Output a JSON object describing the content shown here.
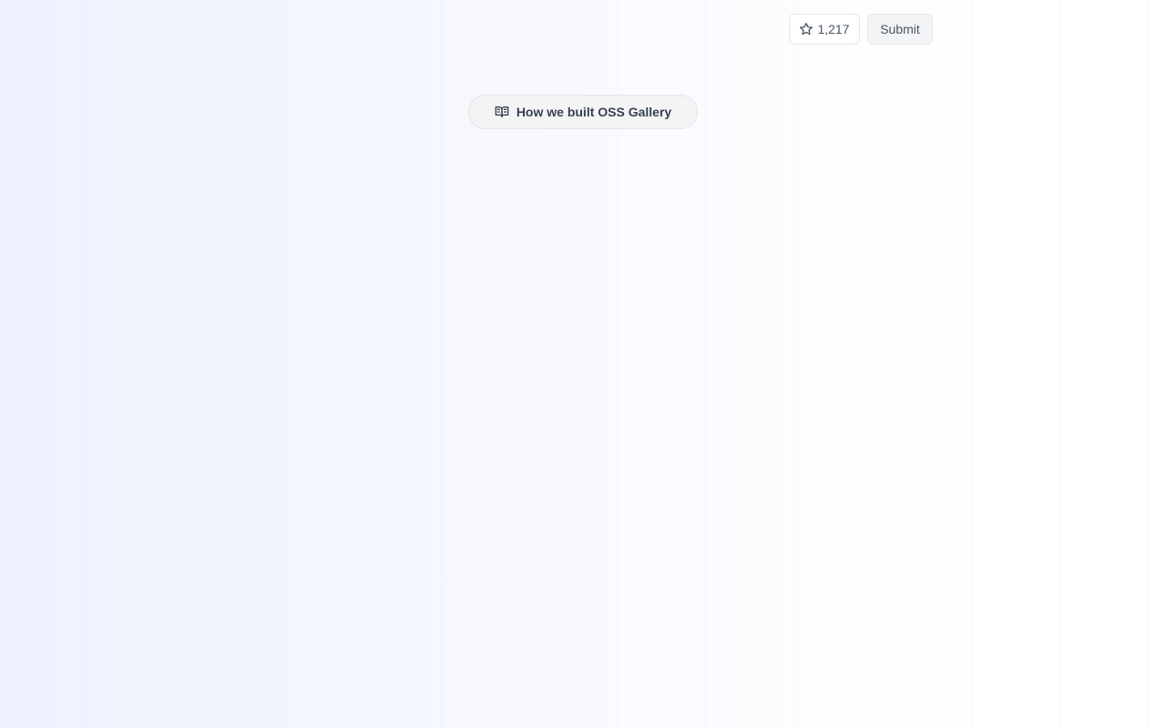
{
  "header": {
    "star_count": "1,217",
    "submit_label": "Submit"
  },
  "hero": {
    "announcement_label": "How we built OSS Gallery"
  },
  "icons": {
    "star": "star-icon",
    "book": "book-open-icon"
  },
  "colors": {
    "background_start": "#eef2ff",
    "background_end": "#ffffff",
    "text": "#374151",
    "border": "#e5e7eb"
  }
}
